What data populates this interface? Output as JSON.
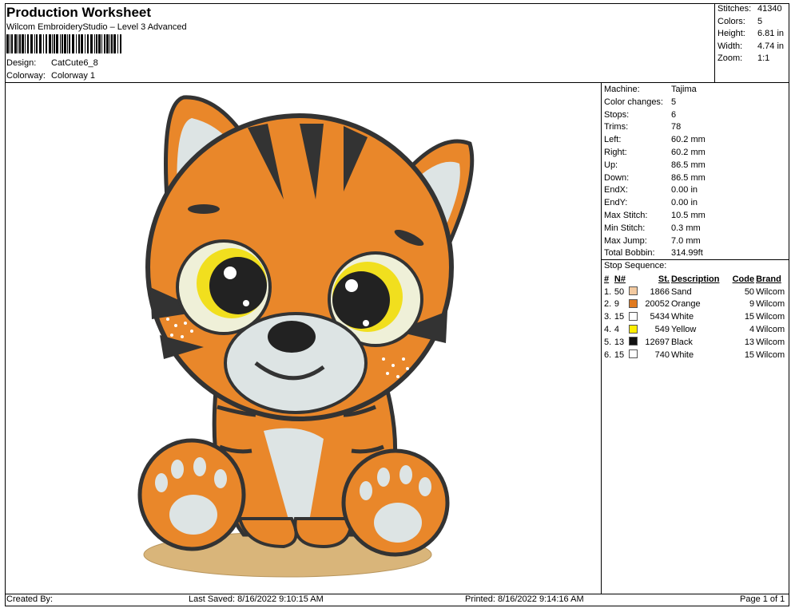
{
  "header": {
    "title": "Production Worksheet",
    "subtitle": "Wilcom EmbroideryStudio – Level 3 Advanced",
    "design_label": "Design:",
    "design_value": "CatCute6_8",
    "colorway_label": "Colorway:",
    "colorway_value": "Colorway 1"
  },
  "stats": [
    {
      "label": "Stitches:",
      "value": "41340"
    },
    {
      "label": "Colors:",
      "value": "5"
    },
    {
      "label": "Height:",
      "value": "6.81 in"
    },
    {
      "label": "Width:",
      "value": "4.74 in"
    },
    {
      "label": "Zoom:",
      "value": "1:1"
    }
  ],
  "info": [
    {
      "label": "Machine:",
      "value": "Tajima"
    },
    {
      "label": "Color changes:",
      "value": "5"
    },
    {
      "label": "Stops:",
      "value": "6"
    },
    {
      "label": "Trims:",
      "value": "78"
    },
    {
      "label": "Left:",
      "value": "60.2 mm"
    },
    {
      "label": "Right:",
      "value": "60.2 mm"
    },
    {
      "label": "Up:",
      "value": "86.5 mm"
    },
    {
      "label": "Down:",
      "value": "86.5 mm"
    },
    {
      "label": "EndX:",
      "value": "0.00 in"
    },
    {
      "label": "EndY:",
      "value": "0.00 in"
    },
    {
      "label": "Max Stitch:",
      "value": "10.5 mm"
    },
    {
      "label": "Min Stitch:",
      "value": "0.3 mm"
    },
    {
      "label": "Max Jump:",
      "value": "7.0 mm"
    },
    {
      "label": "Total Bobbin:",
      "value": "314.99ft"
    }
  ],
  "stop_sequence": {
    "title": "Stop Sequence:",
    "headers": [
      "#",
      "N#",
      "St.",
      "Description",
      "Code",
      "Brand"
    ],
    "rows": [
      {
        "idx": "1.",
        "n": "50",
        "color": "#f2c9a0",
        "st": "1866",
        "desc": "Sand",
        "code": "50",
        "brand": "Wilcom"
      },
      {
        "idx": "2.",
        "n": "9",
        "color": "#e07a1f",
        "st": "20052",
        "desc": "Orange",
        "code": "9",
        "brand": "Wilcom"
      },
      {
        "idx": "3.",
        "n": "15",
        "color": "#ffffff",
        "st": "5434",
        "desc": "White",
        "code": "15",
        "brand": "Wilcom"
      },
      {
        "idx": "4.",
        "n": "4",
        "color": "#ffee00",
        "st": "549",
        "desc": "Yellow",
        "code": "4",
        "brand": "Wilcom"
      },
      {
        "idx": "5.",
        "n": "13",
        "color": "#111111",
        "st": "12697",
        "desc": "Black",
        "code": "13",
        "brand": "Wilcom"
      },
      {
        "idx": "6.",
        "n": "15",
        "color": "#ffffff",
        "st": "740",
        "desc": "White",
        "code": "15",
        "brand": "Wilcom"
      }
    ]
  },
  "footer": {
    "created_by": "Created By:",
    "last_saved": "Last Saved: 8/16/2022 9:10:15 AM",
    "printed": "Printed: 8/16/2022 9:14:16 AM",
    "page": "Page 1 of 1"
  }
}
